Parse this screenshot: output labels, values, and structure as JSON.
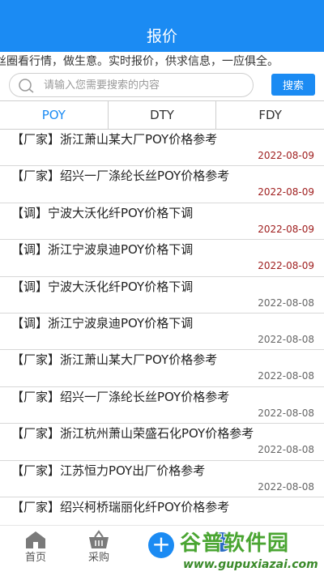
{
  "header": {
    "title": "报价"
  },
  "marquee": {
    "text": "丝圈看行情，做生意。实时报价，供求信息，一应俱全。"
  },
  "search": {
    "placeholder": "请输入您需要搜索的内容",
    "value": "",
    "button_label": "搜索"
  },
  "tabs": [
    {
      "label": "POY",
      "active": true
    },
    {
      "label": "DTY",
      "active": false
    },
    {
      "label": "FDY",
      "active": false
    }
  ],
  "items": [
    {
      "title": "【厂家】浙江萧山某大厂POY价格参考",
      "date": "2022-08-09"
    },
    {
      "title": "【厂家】绍兴一厂涤纶长丝POY价格参考",
      "date": "2022-08-09"
    },
    {
      "title": "【调】宁波大沃化纤POY价格下调",
      "date": "2022-08-09"
    },
    {
      "title": "【调】浙江宁波泉迪POY价格下调",
      "date": "2022-08-09"
    },
    {
      "title": "【调】宁波大沃化纤POY价格下调",
      "date": "2022-08-08"
    },
    {
      "title": "【调】浙江宁波泉迪POY价格下调",
      "date": "2022-08-08"
    },
    {
      "title": "【厂家】浙江萧山某大厂POY价格参考",
      "date": "2022-08-08"
    },
    {
      "title": "【厂家】绍兴一厂涤纶长丝POY价格参考",
      "date": "2022-08-08"
    },
    {
      "title": "【厂家】浙江杭州萧山荣盛石化POY价格参考",
      "date": "2022-08-08"
    },
    {
      "title": "【厂家】江苏恒力POY出厂价格参考",
      "date": "2022-08-08"
    },
    {
      "title": "【厂家】绍兴柯桥瑞丽化纤POY价格参考",
      "date": ""
    }
  ],
  "bottom_nav": {
    "home_label": "首页",
    "purchase_label": "采购",
    "add_symbol": "+"
  },
  "watermark": {
    "logo": "谷普软件园",
    "url": "www.gupuxiazai.com"
  },
  "colors": {
    "accent": "#1b8bf3",
    "recent_date": "#a02020",
    "normal_date": "#666666"
  }
}
